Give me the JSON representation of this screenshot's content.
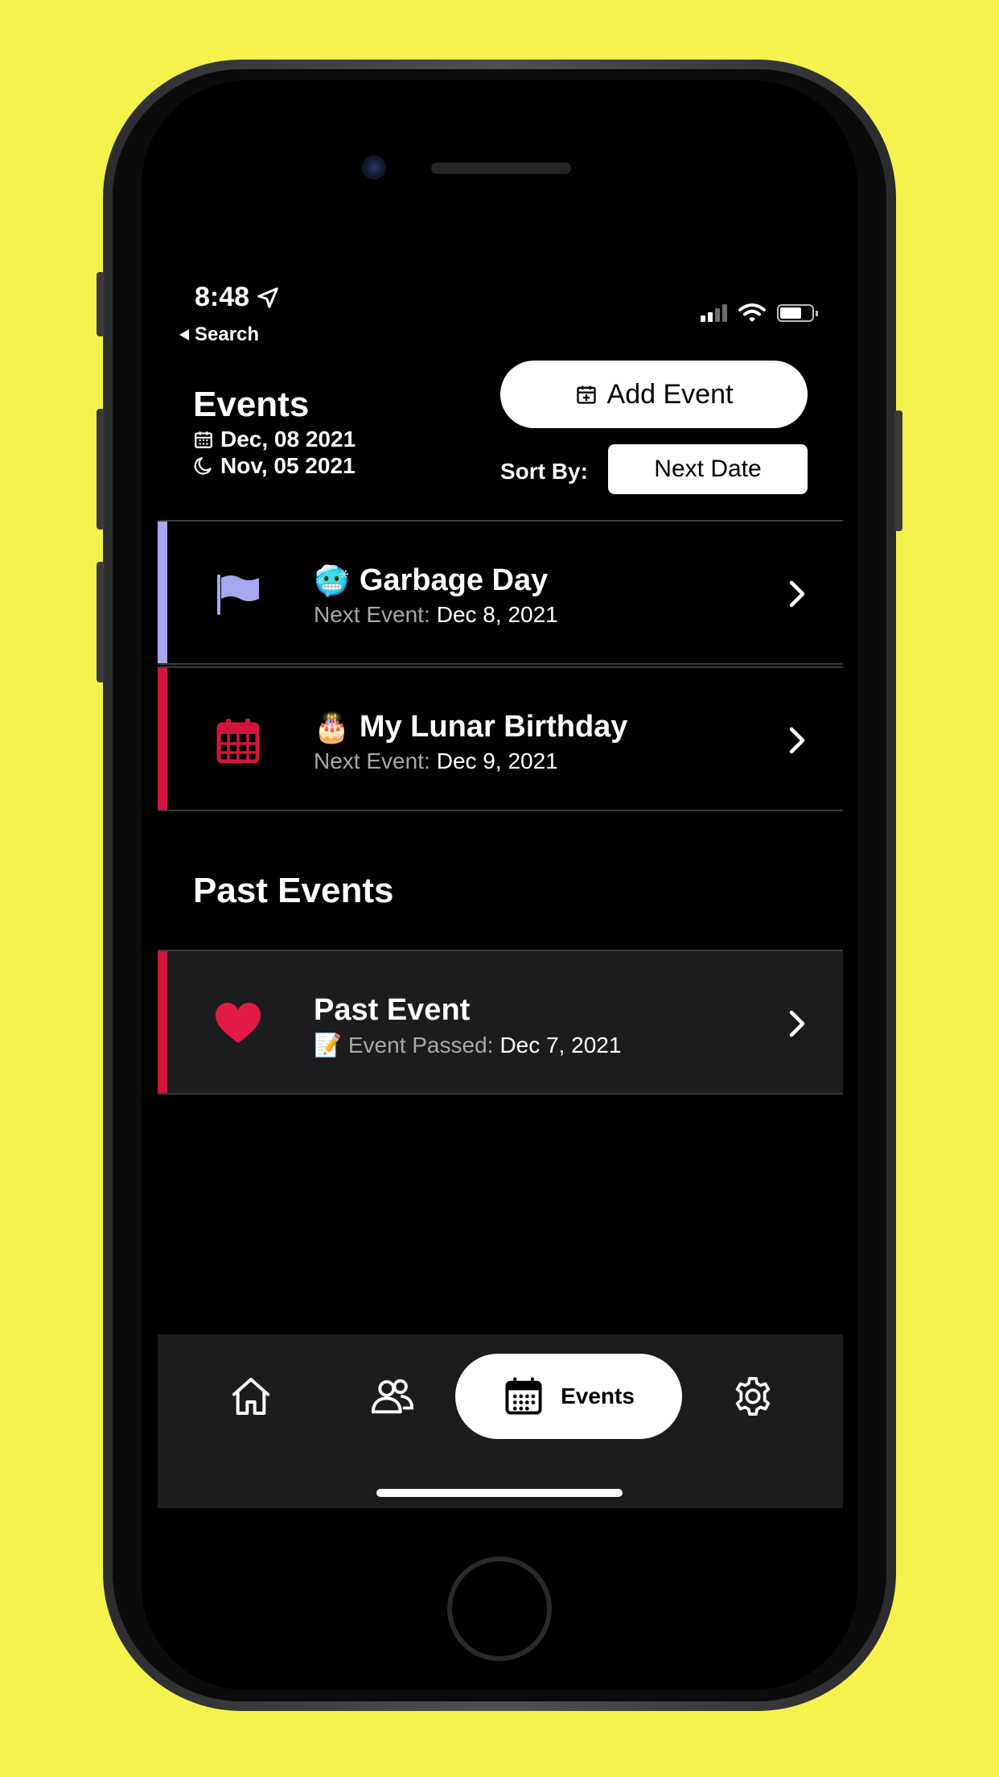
{
  "status_bar": {
    "time": "8:48",
    "back_label": "Search",
    "icons": [
      "location-arrow-icon",
      "signal-icon",
      "wifi-icon",
      "battery-icon"
    ]
  },
  "header": {
    "title": "Events",
    "date_gregorian": "Dec, 08 2021",
    "date_lunar": "Nov, 05 2021",
    "add_event_label": "Add Event",
    "sort_label": "Sort By:",
    "sort_value": "Next Date"
  },
  "upcoming_events": [
    {
      "emoji": "🥶",
      "title": "Garbage Day",
      "sub_label": "Next Event:",
      "sub_value": "Dec 8, 2021",
      "icon": "flag-icon",
      "accent": "#a7a7ef"
    },
    {
      "emoji": "🎂",
      "title": "My Lunar Birthday",
      "sub_label": "Next Event:",
      "sub_value": "Dec 9, 2021",
      "icon": "calendar-icon",
      "accent": "#d0163d"
    }
  ],
  "past_section": {
    "title": "Past Events",
    "events": [
      {
        "title": "Past Event",
        "sub_emoji": "📝",
        "sub_label": "Event Passed:",
        "sub_value": "Dec 7, 2021",
        "icon": "heart-icon",
        "accent": "#d0163d"
      }
    ]
  },
  "tab_bar": {
    "tabs": [
      {
        "name": "home",
        "icon": "home-icon"
      },
      {
        "name": "people",
        "icon": "people-icon"
      },
      {
        "name": "events",
        "icon": "calendar-icon",
        "label": "Events",
        "active": true
      },
      {
        "name": "settings",
        "icon": "gear-icon"
      }
    ]
  },
  "colors": {
    "background": "#f4f34d",
    "accent_red": "#d0163d",
    "accent_lavender": "#a7a7ef",
    "tab_bar": "#1c1c1e"
  }
}
